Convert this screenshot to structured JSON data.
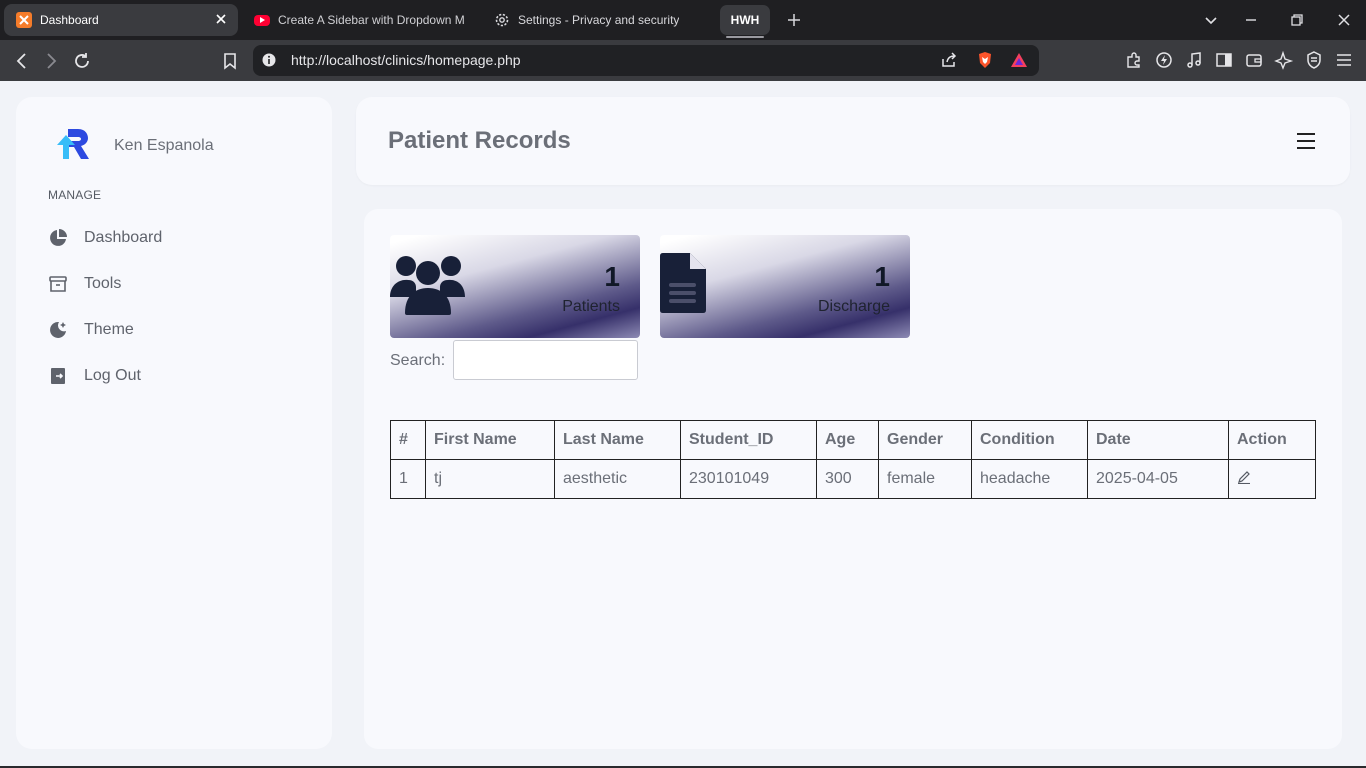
{
  "browser": {
    "tabs": [
      {
        "title": "Dashboard",
        "icon": "xampp-icon",
        "active": true
      },
      {
        "title": "Create A Sidebar with Dropdown M",
        "icon": "youtube-icon",
        "active": false
      },
      {
        "title": "Settings - Privacy and security",
        "icon": "gear-icon",
        "active": false
      }
    ],
    "tab_group_label": "HWH",
    "url": "http://localhost/clinics/homepage.php"
  },
  "sidebar": {
    "user_name": "Ken Espanola",
    "section_label": "MANAGE",
    "items": [
      {
        "label": "Dashboard",
        "icon": "pie-chart-icon"
      },
      {
        "label": "Tools",
        "icon": "archive-box-icon"
      },
      {
        "label": "Theme",
        "icon": "theme-moon-icon"
      },
      {
        "label": "Log Out",
        "icon": "logout-icon"
      }
    ]
  },
  "header": {
    "title": "Patient Records"
  },
  "stats": [
    {
      "value": "1",
      "label": "Patients",
      "icon": "users-group-icon"
    },
    {
      "value": "1",
      "label": "Discharge",
      "icon": "document-icon"
    }
  ],
  "search": {
    "label": "Search:",
    "value": "",
    "placeholder": ""
  },
  "table": {
    "headers": [
      "#",
      "First Name",
      "Last Name",
      "Student_ID",
      "Age",
      "Gender",
      "Condition",
      "Date",
      "Action"
    ],
    "rows": [
      [
        "1",
        "tj",
        "aesthetic",
        "230101049",
        "300",
        "female",
        "headache",
        "2025-04-05",
        "edit-icon"
      ]
    ]
  },
  "colors": {
    "accent_blue": "#2563eb",
    "accent_cyan": "#38bdf8",
    "card_gradient_dark": "#36306a"
  }
}
